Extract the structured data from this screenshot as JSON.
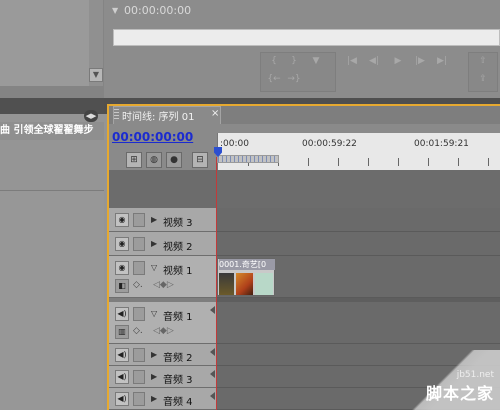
{
  "monitor": {
    "timecode": "00:00:00:00"
  },
  "project_panel": {
    "header_text": "曲 引领全球翟翟舞步"
  },
  "timeline": {
    "tab_label": "时间线: 序列 01",
    "close_glyph": "×",
    "current_timecode": "00:00:00:00",
    "ruler_labels": [
      ":00:00",
      "00:00:59:22",
      "00:01:59:21"
    ],
    "tracks": {
      "video": [
        {
          "name": "视频 3"
        },
        {
          "name": "视频 2"
        },
        {
          "name": "视频 1"
        }
      ],
      "audio": [
        {
          "name": "音频 1"
        },
        {
          "name": "音频 2"
        },
        {
          "name": "音频 3"
        },
        {
          "name": "音频 4"
        }
      ]
    },
    "clip": {
      "title": "0001.奇艺[0"
    }
  },
  "watermark": {
    "site": "jb51.net",
    "name": "脚本之家"
  },
  "colors": {
    "panel_focus": "#e6a930",
    "timecode_blue": "#1b2bd0",
    "playhead": "#c23a3a"
  }
}
